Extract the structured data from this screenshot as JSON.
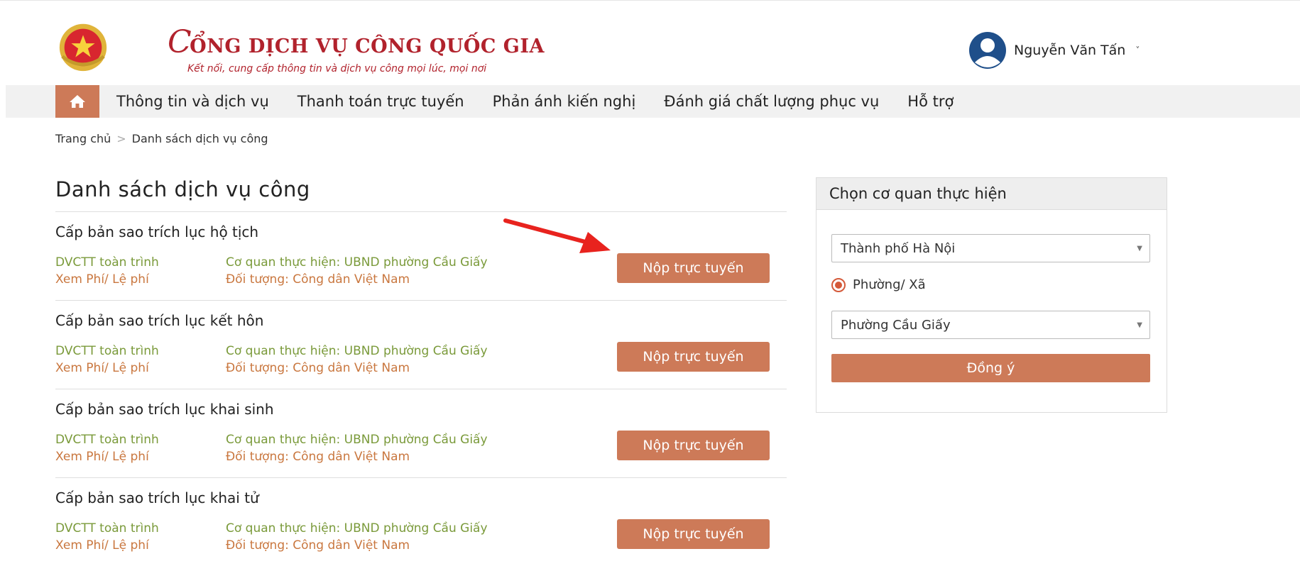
{
  "header": {
    "brand_initial": "C",
    "brand_title": "ỔNG DỊCH VỤ CÔNG QUỐC GIA",
    "slogan": "Kết nối, cung cấp thông tin và dịch vụ công mọi lúc, mọi nơi",
    "user_name": "Nguyễn Văn Tấn",
    "user_chevron": "˅"
  },
  "nav": {
    "home_icon": "home-icon",
    "items": [
      {
        "label": "Thông tin và dịch vụ"
      },
      {
        "label": "Thanh toán trực tuyến"
      },
      {
        "label": "Phản ánh kiến nghị"
      },
      {
        "label": "Đánh giá chất lượng phục vụ"
      },
      {
        "label": "Hỗ trợ"
      }
    ]
  },
  "breadcrumb": {
    "home": "Trang chủ",
    "separator": ">",
    "current": "Danh sách dịch vụ công"
  },
  "list": {
    "title": "Danh sách dịch vụ công",
    "items": [
      {
        "name": "Cấp bản sao trích lục hộ tịch",
        "type": "DVCTT toàn trình",
        "fee": "Xem Phí/ Lệ phí",
        "agency": "Cơ quan thực hiện: UBND phường Cầu Giấy",
        "target": "Đối tượng: Công dân Việt Nam",
        "button": "Nộp trực tuyến"
      },
      {
        "name": "Cấp bản sao trích lục kết hôn",
        "type": "DVCTT toàn trình",
        "fee": "Xem Phí/ Lệ phí",
        "agency": "Cơ quan thực hiện: UBND phường Cầu Giấy",
        "target": "Đối tượng: Công dân Việt Nam",
        "button": "Nộp trực tuyến"
      },
      {
        "name": "Cấp bản sao trích lục khai sinh",
        "type": "DVCTT toàn trình",
        "fee": "Xem Phí/ Lệ phí",
        "agency": "Cơ quan thực hiện: UBND phường Cầu Giấy",
        "target": "Đối tượng: Công dân Việt Nam",
        "button": "Nộp trực tuyến"
      },
      {
        "name": "Cấp bản sao trích lục khai tử",
        "type": "DVCTT toàn trình",
        "fee": "Xem Phí/ Lệ phí",
        "agency": "Cơ quan thực hiện: UBND phường Cầu Giấy",
        "target": "Đối tượng: Công dân Việt Nam",
        "button": "Nộp trực tuyến"
      }
    ]
  },
  "panel": {
    "title": "Chọn cơ quan thực hiện",
    "city_select": "Thành phố Hà Nội",
    "radio_label": "Phường/ Xã",
    "ward_select": "Phường Cầu Giấy",
    "agree_button": "Đồng ý"
  },
  "colors": {
    "accent": "#cd7a58",
    "brand_red": "#b1222c",
    "green_text": "#7a9a3a",
    "orange_text": "#c9773f",
    "arrow_red": "#e8231e"
  }
}
